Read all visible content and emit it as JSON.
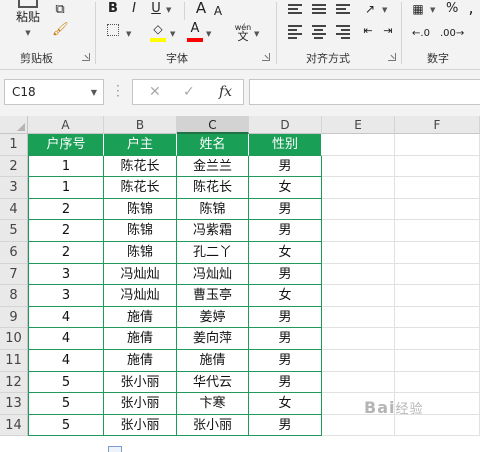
{
  "ribbon": {
    "clipboard": {
      "label": "剪贴板",
      "paste_label": "粘贴"
    },
    "font": {
      "label": "字体",
      "bold": "B",
      "italic": "I",
      "underline": "U",
      "grow": "A",
      "shrink": "A",
      "wen_top": "wén",
      "wen_bottom": "文",
      "font_color_letter": "A",
      "fill_color": "#ffff00",
      "font_color": "#ff0000"
    },
    "alignment": {
      "label": "对齐方式"
    },
    "number": {
      "label": "数字",
      "percent": "%",
      "comma": ","
    }
  },
  "formula_bar": {
    "name_box": "C18",
    "cancel": "✕",
    "enter": "✓",
    "fx": "fx",
    "formula": ""
  },
  "grid": {
    "columns": [
      "A",
      "B",
      "C",
      "D",
      "E",
      "F"
    ],
    "selected_column": "C",
    "headers": [
      "户序号",
      "户主",
      "姓名",
      "性别"
    ],
    "rows": [
      {
        "num": "1",
        "cells": [
          "",
          "",
          "",
          ""
        ]
      },
      {
        "num": "2",
        "cells": [
          "1",
          "陈花长",
          "金兰兰",
          "男"
        ]
      },
      {
        "num": "3",
        "cells": [
          "1",
          "陈花长",
          "陈花长",
          "女"
        ]
      },
      {
        "num": "4",
        "cells": [
          "2",
          "陈锦",
          "陈锦",
          "男"
        ]
      },
      {
        "num": "5",
        "cells": [
          "2",
          "陈锦",
          "冯紫霜",
          "男"
        ]
      },
      {
        "num": "6",
        "cells": [
          "2",
          "陈锦",
          "孔二丫",
          "女"
        ]
      },
      {
        "num": "7",
        "cells": [
          "3",
          "冯灿灿",
          "冯灿灿",
          "男"
        ]
      },
      {
        "num": "8",
        "cells": [
          "3",
          "冯灿灿",
          "曹玉亭",
          "女"
        ]
      },
      {
        "num": "9",
        "cells": [
          "4",
          "施倩",
          "姜婷",
          "男"
        ]
      },
      {
        "num": "10",
        "cells": [
          "4",
          "施倩",
          "姜向萍",
          "男"
        ]
      },
      {
        "num": "11",
        "cells": [
          "4",
          "施倩",
          "施倩",
          "男"
        ]
      },
      {
        "num": "12",
        "cells": [
          "5",
          "张小丽",
          "华代云",
          "男"
        ]
      },
      {
        "num": "13",
        "cells": [
          "5",
          "张小丽",
          "卞寒",
          "女"
        ]
      },
      {
        "num": "14",
        "cells": [
          "5",
          "张小丽",
          "张小丽",
          "男"
        ]
      }
    ],
    "header_color": "#1a9f56",
    "border_color": "#1f9a5b"
  },
  "watermark": {
    "text": "Bai",
    "sub": "经验"
  }
}
